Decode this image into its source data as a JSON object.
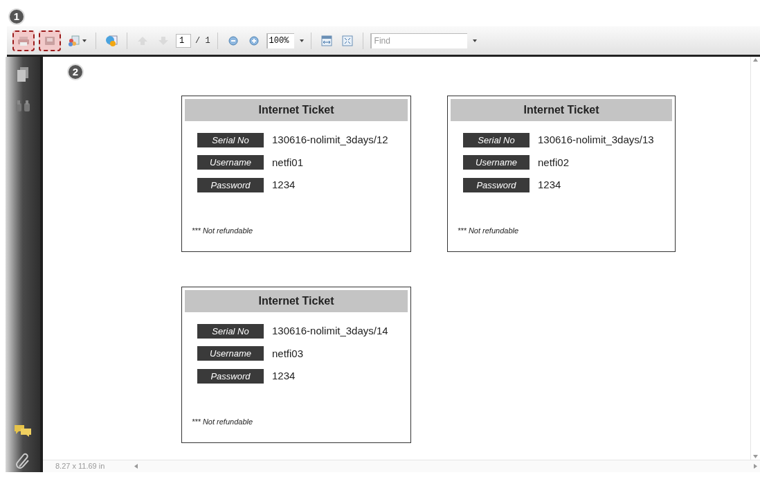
{
  "callouts": [
    {
      "label": "1"
    },
    {
      "label": "2"
    }
  ],
  "toolbar": {
    "items": [
      {
        "kind": "print",
        "highlighted": true,
        "dropdown": false
      },
      {
        "kind": "save",
        "highlighted": true,
        "dropdown": false
      },
      {
        "kind": "share",
        "highlighted": false,
        "dropdown": true
      },
      {
        "kind": "sep"
      },
      {
        "kind": "web",
        "highlighted": false,
        "dropdown": false
      },
      {
        "kind": "sep"
      },
      {
        "kind": "prev",
        "highlighted": false,
        "dropdown": false,
        "disabled": true
      },
      {
        "kind": "next",
        "highlighted": false,
        "dropdown": false,
        "disabled": true
      },
      {
        "kind": "page",
        "value": "1",
        "total": "/ 1"
      },
      {
        "kind": "sep"
      },
      {
        "kind": "zoomout",
        "highlighted": false,
        "dropdown": false
      },
      {
        "kind": "zoomin",
        "highlighted": false,
        "dropdown": false
      },
      {
        "kind": "zoom",
        "value": "100%"
      },
      {
        "kind": "sep"
      },
      {
        "kind": "fitwidth",
        "highlighted": false,
        "dropdown": false
      },
      {
        "kind": "fitpage",
        "highlighted": false,
        "dropdown": false
      },
      {
        "kind": "sep"
      },
      {
        "kind": "find",
        "placeholder": "Find"
      }
    ]
  },
  "tickets": [
    {
      "title": "Internet Ticket",
      "fields": [
        {
          "label": "Serial No",
          "value": "130616-nolimit_3days/12"
        },
        {
          "label": "Username",
          "value": "netfi01"
        },
        {
          "label": "Password",
          "value": "1234"
        }
      ],
      "note": "*** Not refundable"
    },
    {
      "title": "Internet Ticket",
      "fields": [
        {
          "label": "Serial No",
          "value": "130616-nolimit_3days/13"
        },
        {
          "label": "Username",
          "value": "netfi02"
        },
        {
          "label": "Password",
          "value": "1234"
        }
      ],
      "note": "*** Not refundable"
    },
    {
      "title": "Internet Ticket",
      "fields": [
        {
          "label": "Serial No",
          "value": "130616-nolimit_3days/14"
        },
        {
          "label": "Username",
          "value": "netfi03"
        },
        {
          "label": "Password",
          "value": "1234"
        }
      ],
      "note": "*** Not refundable"
    }
  ],
  "status_bar": {
    "page_size": "8.27 x 11.69 in"
  }
}
